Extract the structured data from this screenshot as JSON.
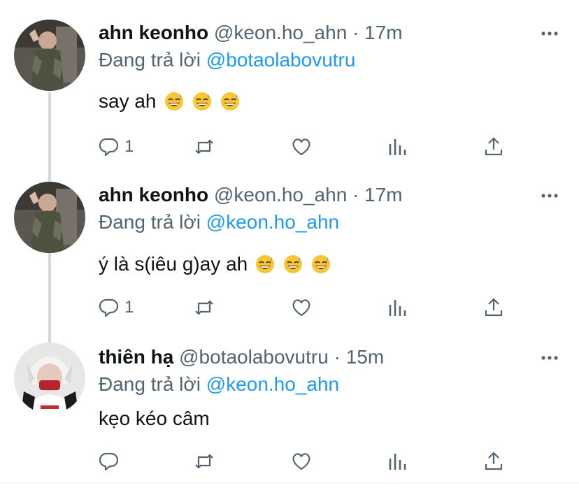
{
  "colors": {
    "accent": "#1d9bf0",
    "secondary_text": "#536471",
    "thread_line": "#cfd9de"
  },
  "tweets": [
    {
      "name": "ahn keonho",
      "handle": "@keon.ho_ahn",
      "dot": "·",
      "time": "17m",
      "replying_prefix": "Đang trả lời ",
      "replying_to": "@botaolabovutru",
      "text": "say ah",
      "emoji": [
        "grinning-sweat-emoji",
        "grinning-sweat-emoji",
        "grinning-sweat-emoji"
      ],
      "reply_count": "1"
    },
    {
      "name": "ahn keonho",
      "handle": "@keon.ho_ahn",
      "dot": "·",
      "time": "17m",
      "replying_prefix": "Đang trả lời ",
      "replying_to": "@keon.ho_ahn",
      "text": "ý là s(iêu g)ay ah",
      "emoji": [
        "grinning-sweat-emoji",
        "grinning-sweat-emoji",
        "grinning-sweat-emoji"
      ],
      "reply_count": "1"
    },
    {
      "name": "thiên hạ",
      "handle": "@botaolabovutru",
      "dot": "·",
      "time": "15m",
      "replying_prefix": "Đang trả lời ",
      "replying_to": "@keon.ho_ahn",
      "text": "kẹo kéo câm",
      "emoji": [],
      "reply_count": ""
    }
  ],
  "icons": {
    "reply": "reply-icon",
    "retweet": "retweet-icon",
    "like": "heart-icon",
    "views": "views-chart-icon",
    "share": "share-icon",
    "more": "more-dots-icon"
  }
}
